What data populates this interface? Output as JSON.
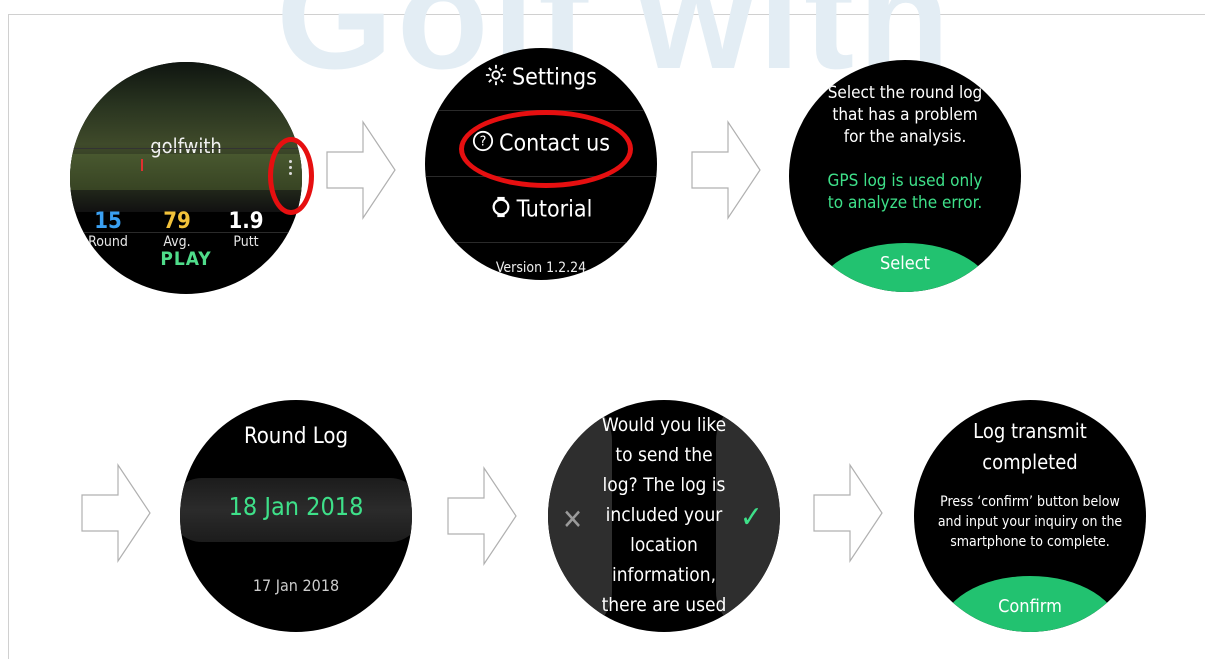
{
  "watermark": "Golf with",
  "colors": {
    "accent_green": "#22c270",
    "highlight_red": "#e60f10"
  },
  "screen_home": {
    "title": "golfwith",
    "stats": [
      {
        "value": "15",
        "label": "Round",
        "color": "#3aa0f2"
      },
      {
        "value": "79",
        "label": "Avg.",
        "color": "#f2c23a"
      },
      {
        "value": "1.9",
        "label": "Putt",
        "color": "#ffffff"
      }
    ],
    "play_label": "PLAY",
    "more_icon": "more-vertical-icon"
  },
  "screen_menu": {
    "items": [
      {
        "label": "Settings",
        "icon": "gear-icon"
      },
      {
        "label": "Contact us",
        "icon": "question-circle-icon"
      },
      {
        "label": "Tutorial",
        "icon": "watch-icon"
      }
    ],
    "version": "Version 1.2.24"
  },
  "screen_select": {
    "lines": [
      "Select the round log",
      "that has a problem",
      "for the analysis."
    ],
    "note_lines": [
      "GPS log is used only",
      "to analyze the error."
    ],
    "button_label": "Select"
  },
  "screen_roundlog": {
    "title": "Round Log",
    "selected_date": "18 Jan 2018",
    "other_date": "17 Jan 2018"
  },
  "screen_send": {
    "lines": [
      "Would you like",
      "to send the",
      "log? The log is",
      "included your",
      "location",
      "information,",
      "there are used"
    ],
    "cancel_icon": "close-icon",
    "confirm_icon": "checkmark-icon"
  },
  "screen_complete": {
    "title_lines": [
      "Log transmit",
      "completed"
    ],
    "body_lines": [
      "Press ‘confirm’ button below",
      "and input your inquiry on the",
      "smartphone to complete."
    ],
    "button_label": "Confirm"
  }
}
